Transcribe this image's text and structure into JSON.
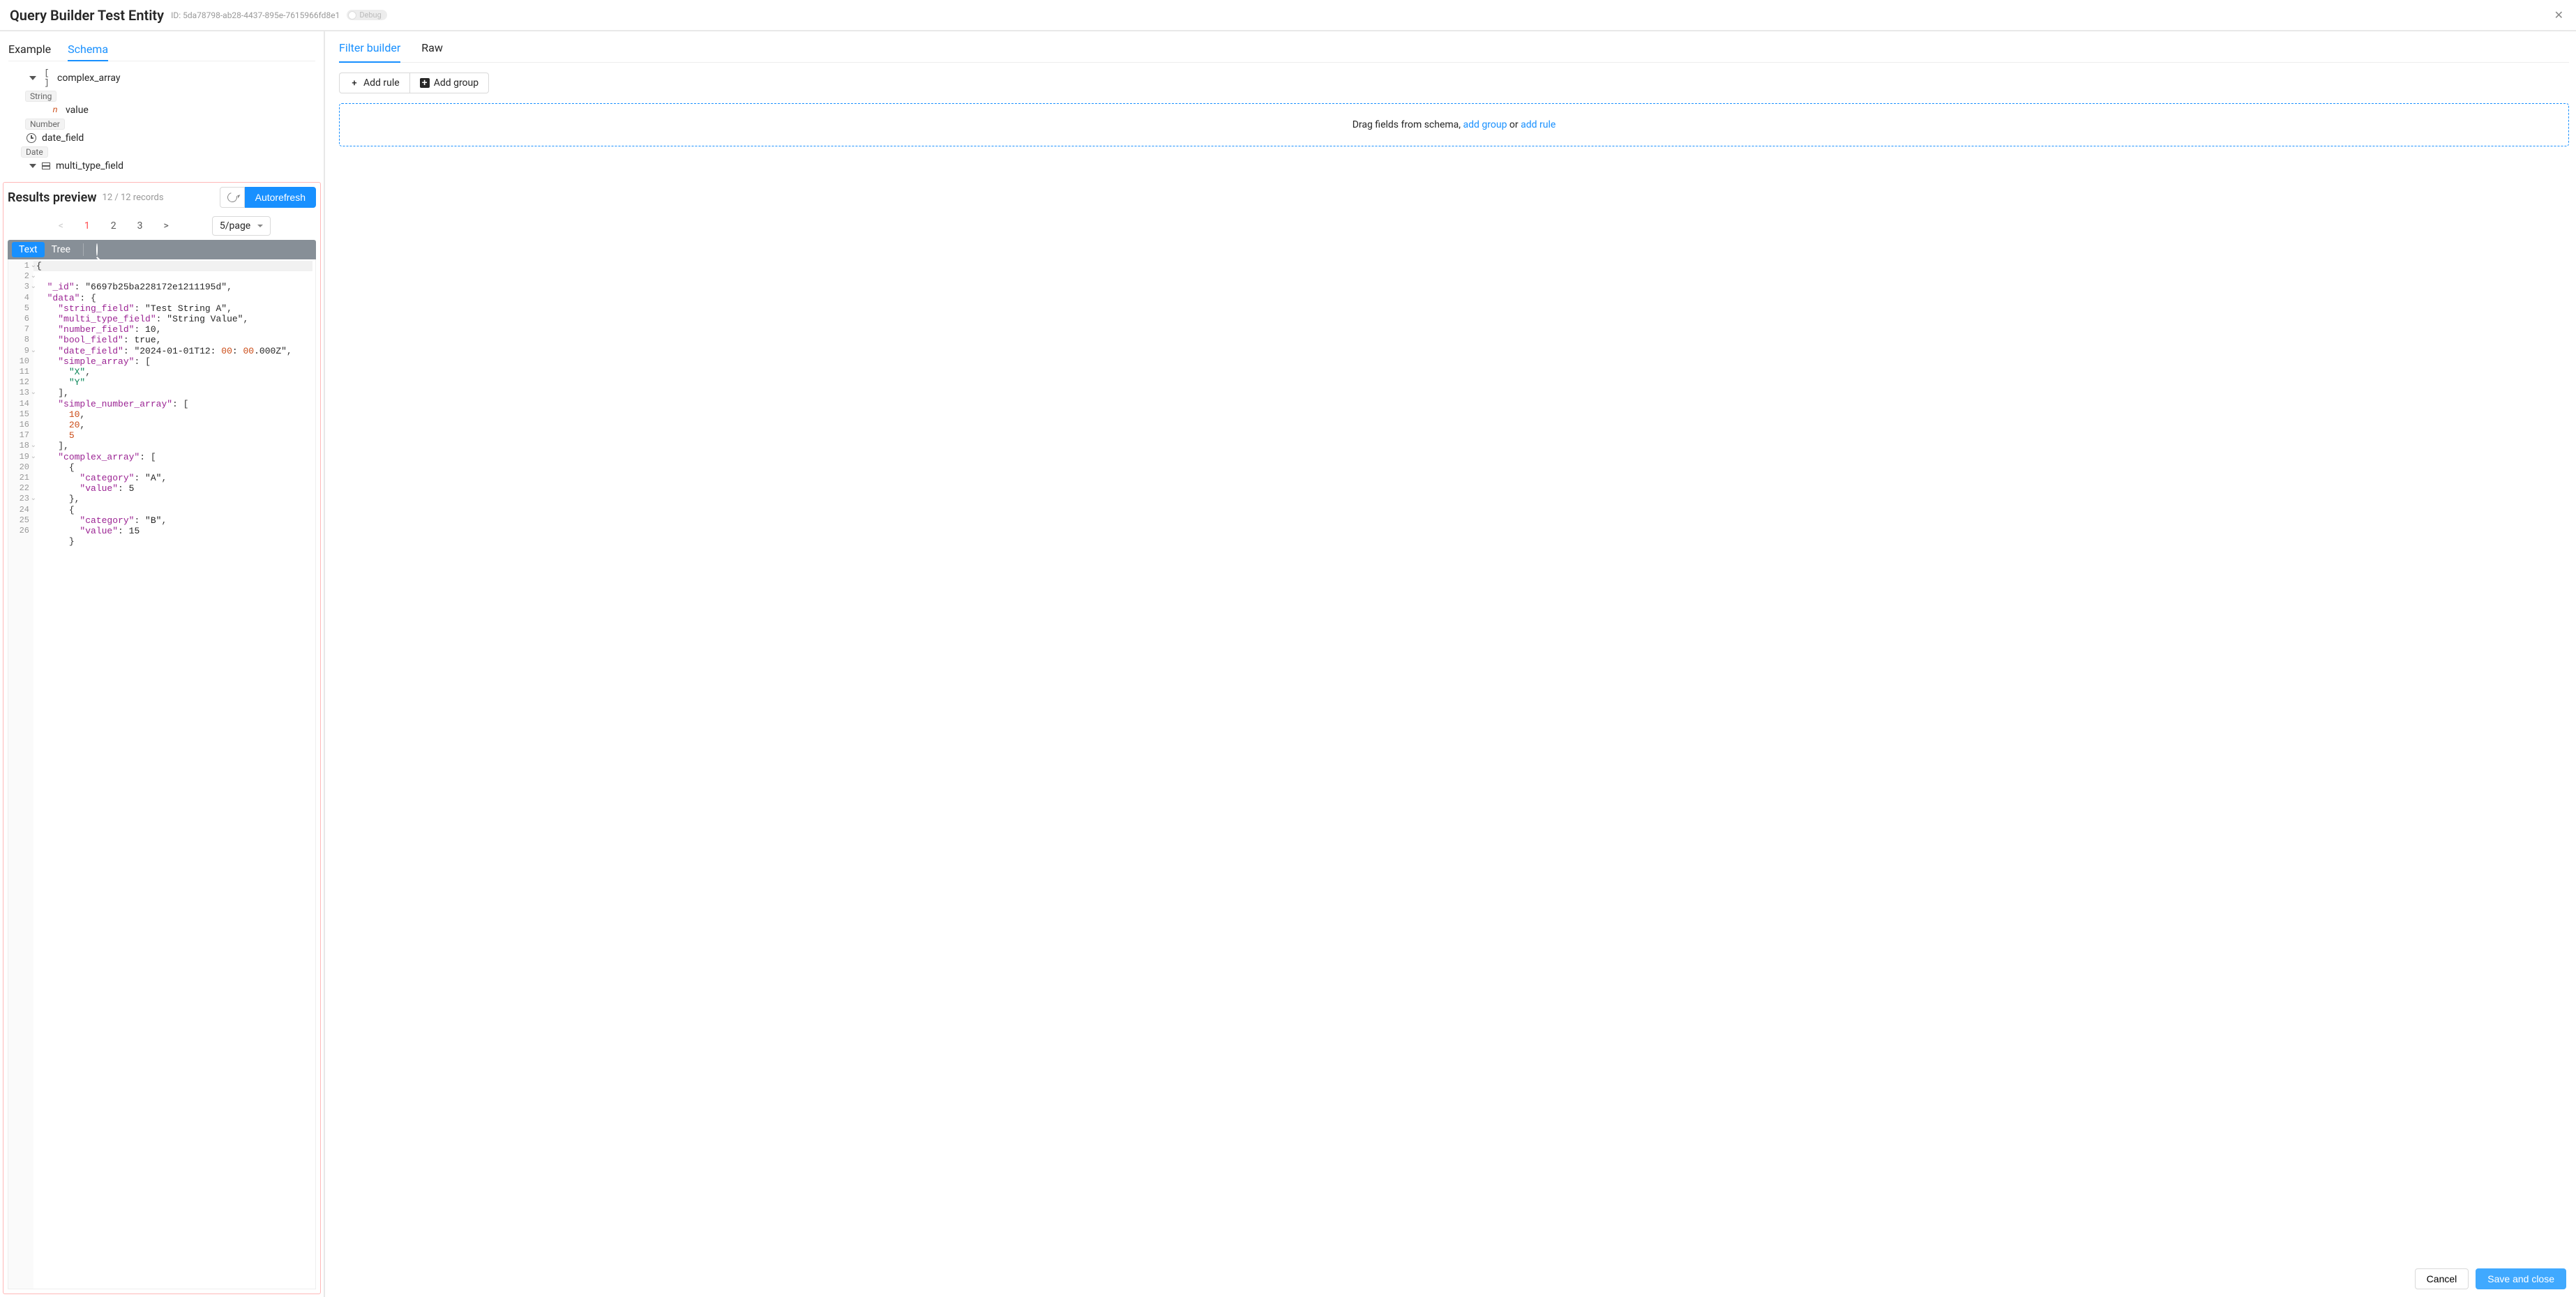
{
  "header": {
    "title": "Query Builder Test Entity",
    "id_label": "ID:",
    "id_value": "5da78798-ab28-4437-895e-7615966fd8e1",
    "debug": "Debug"
  },
  "leftTabs": {
    "example": "Example",
    "schema": "Schema"
  },
  "schemaTree": {
    "complex_array": "complex_array",
    "string_tag": "String",
    "value_label": "value",
    "number_tag": "Number",
    "date_field": "date_field",
    "date_tag": "Date",
    "multi_type_field": "multi_type_field"
  },
  "results": {
    "title": "Results preview",
    "records": "12 / 12 records",
    "autorefresh": "Autorefresh",
    "pages": [
      "1",
      "2",
      "3"
    ],
    "page_size": "5/page",
    "view_text": "Text",
    "view_tree": "Tree"
  },
  "code": {
    "lines": [
      "{",
      "  \"_id\": \"6697b25ba228172e1211195d\",",
      "  \"data\": {",
      "    \"string_field\": \"Test String A\",",
      "    \"multi_type_field\": \"String Value\",",
      "    \"number_field\": 10,",
      "    \"bool_field\": true,",
      "    \"date_field\": \"2024-01-01T12:00:00.000Z\",",
      "    \"simple_array\": [",
      "      \"X\",",
      "      \"Y\"",
      "    ],",
      "    \"simple_number_array\": [",
      "      10,",
      "      20,",
      "      5",
      "    ],",
      "    \"complex_array\": [",
      "      {",
      "        \"category\": \"A\",",
      "        \"value\": 5",
      "      },",
      "      {",
      "        \"category\": \"B\",",
      "        \"value\": 15",
      "      }"
    ],
    "foldable": [
      1,
      2,
      3,
      9,
      13,
      18,
      19,
      23
    ]
  },
  "rightTabs": {
    "filter": "Filter builder",
    "raw": "Raw"
  },
  "buttons": {
    "add_rule": "Add rule",
    "add_group": "Add group"
  },
  "dropzone": {
    "prefix": "Drag fields from schema, ",
    "add_group": "add group",
    "or": " or ",
    "add_rule": "add rule"
  },
  "footer": {
    "cancel": "Cancel",
    "save": "Save and close"
  }
}
